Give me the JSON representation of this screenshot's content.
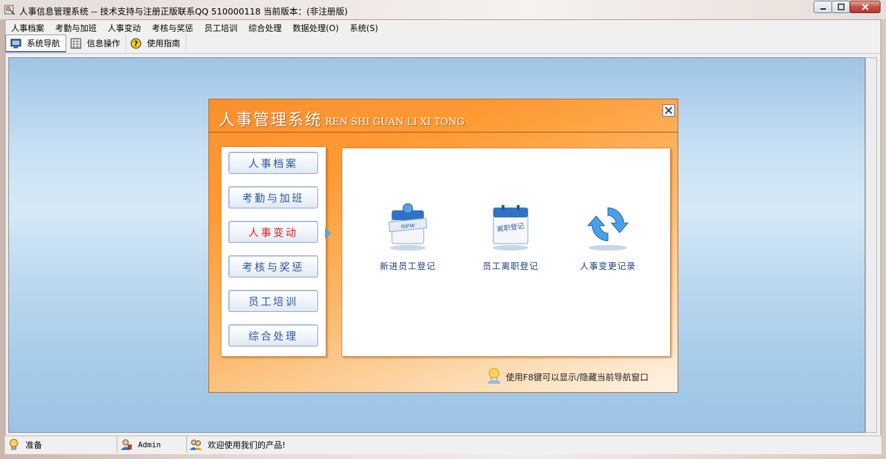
{
  "window": {
    "title": "人事信息管理系统 -- 技术支持与注册正版联系QQ 510000118   当前版本：(非注册版)"
  },
  "menu": [
    "人事档案",
    "考勤与加班",
    "人事变动",
    "考核与奖惩",
    "员工培训",
    "综合处理",
    "数据处理(O)",
    "系统(S)"
  ],
  "toolbar": {
    "nav": "系统导航",
    "info": "信息操作",
    "guide": "使用指南"
  },
  "panel": {
    "title": "人事管理系统",
    "subtitle": "REN SHI GUAN LI XI TONG",
    "nav_buttons": [
      "人事档案",
      "考勤与加班",
      "人事变动",
      "考核与奖惩",
      "员工培训",
      "综合处理"
    ],
    "active_index": 2,
    "functions": [
      {
        "label": "新进员工登记",
        "icon": "new-employee-icon",
        "icon_text": "new"
      },
      {
        "label": "员工离职登记",
        "icon": "resignation-icon",
        "icon_text": "离职登记"
      },
      {
        "label": "人事变更记录",
        "icon": "change-record-icon"
      }
    ],
    "hint": "使用F8键可以显示/隐藏当前导航窗口"
  },
  "status": {
    "ready": "准备",
    "user": "Admin",
    "welcome": "欢迎使用我们的产品!"
  },
  "colors": {
    "panel_orange": "#ff9a33",
    "nav_button_text": "#2a55a0",
    "active_text": "#e02020"
  }
}
